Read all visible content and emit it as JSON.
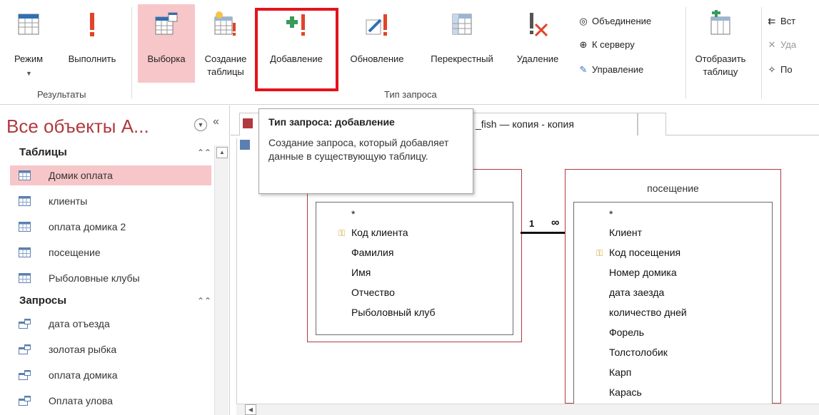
{
  "ribbon": {
    "buttons": [
      {
        "label": "Режим",
        "icon": "view-icon"
      },
      {
        "label": "Выполнить",
        "icon": "run-icon"
      },
      {
        "label": "Выборка",
        "icon": "select-query-icon",
        "selected": true
      },
      {
        "label_line1": "Создание",
        "label_line2": "таблицы",
        "icon": "make-table-icon"
      },
      {
        "label": "Добавление",
        "icon": "append-icon"
      },
      {
        "label": "Обновление",
        "icon": "update-icon"
      },
      {
        "label": "Перекрестный",
        "icon": "crosstab-icon"
      },
      {
        "label": "Удаление",
        "icon": "delete-icon"
      },
      {
        "label_line1": "Отобразить",
        "label_line2": "таблицу",
        "icon": "show-table-icon"
      }
    ],
    "small_items": [
      {
        "label": "Объединение",
        "icon": "union-icon"
      },
      {
        "label": "К серверу",
        "icon": "globe-icon"
      },
      {
        "label": "Управление",
        "icon": "data-definition-icon"
      },
      {
        "label": "Вст",
        "icon": "insert-rows-icon"
      },
      {
        "label": "Уда",
        "icon": "delete-rows-icon"
      },
      {
        "label": "По",
        "icon": "builder-icon"
      }
    ],
    "groups": {
      "results": "Результаты",
      "query_type": "Тип запроса"
    }
  },
  "tooltip": {
    "title": "Тип запроса: добавление",
    "body": "Создание запроса, который добавляет данные в существующую таблицу."
  },
  "nav": {
    "title": "Все объекты A...",
    "sections": [
      {
        "label": "Таблицы",
        "items": [
          "Домик оплата",
          "клиенты",
          "оплата домика 2",
          "посещение",
          "Рыболовные клубы"
        ],
        "selected_index": 0
      },
      {
        "label": "Запросы",
        "items": [
          "дата отъезда",
          "золотая рыбка",
          "оплата домика",
          "Оплата улова"
        ]
      }
    ]
  },
  "document": {
    "tab_label": "_fish — копия - копия",
    "tables": [
      {
        "title": "",
        "fields": [
          "*",
          "Код клиента",
          "Фамилия",
          "Имя",
          "Отчество",
          "Рыболовный клуб"
        ],
        "key_field_index": 1
      },
      {
        "title": "посещение",
        "fields": [
          "*",
          "Клиент",
          "Код посещения",
          "Номер домика",
          "дата заезда",
          "количество дней",
          "Форель",
          "Толстолобик",
          "Карп",
          "Карась"
        ],
        "key_field_index": 2
      }
    ],
    "relationship": {
      "one": "1",
      "many": "∞"
    }
  },
  "colors": {
    "accent": "#b03a3f",
    "selection": "#f7c6c9",
    "highlight_box": "#e5121b"
  }
}
